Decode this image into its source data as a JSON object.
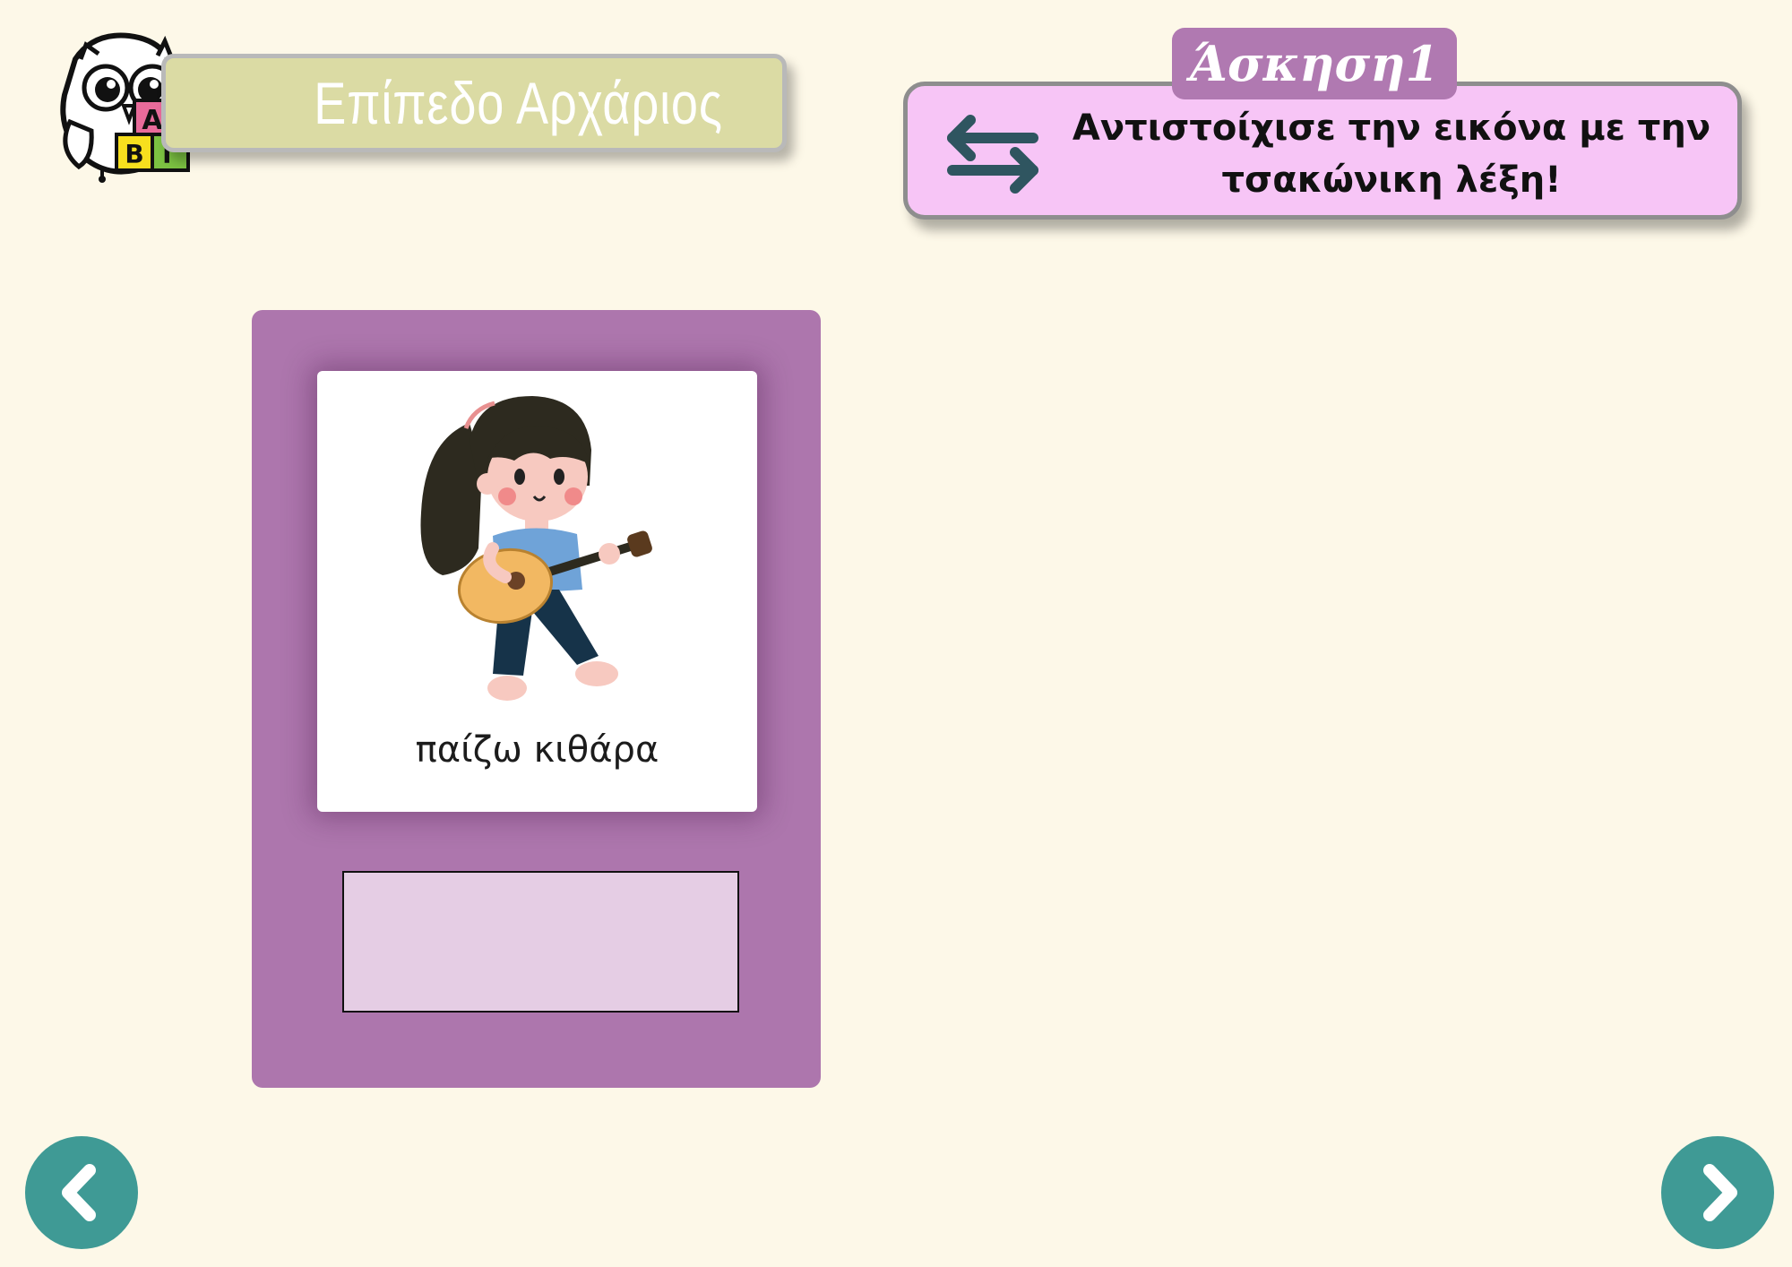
{
  "level": {
    "title": "Επίπεδο Αρχάριος",
    "logo_icon": "owl-with-alphabet-blocks-icon",
    "blocks": [
      "Α",
      "Β",
      "Γ"
    ]
  },
  "exercise": {
    "title": "Άσκηση1",
    "instruction": "Αντιστοίχισε την εικόνα με την τσακώνικη λέξη!",
    "instruction_icon": "swap-arrows-icon"
  },
  "card": {
    "image": "girl-playing-guitar-illustration",
    "word": "παίζω κιθάρα",
    "answer_value": ""
  },
  "navigation": {
    "prev_icon": "chevron-left-icon",
    "next_icon": "chevron-right-icon"
  },
  "colors": {
    "background": "#fdf8e8",
    "level_banner": "#dbdba4",
    "exercise_tab": "#b079b1",
    "instruction_box": "#f7c5f6",
    "card_panel": "#ad76ad",
    "answer_slot": "#e5cde4",
    "nav_button": "#3f9a95"
  }
}
